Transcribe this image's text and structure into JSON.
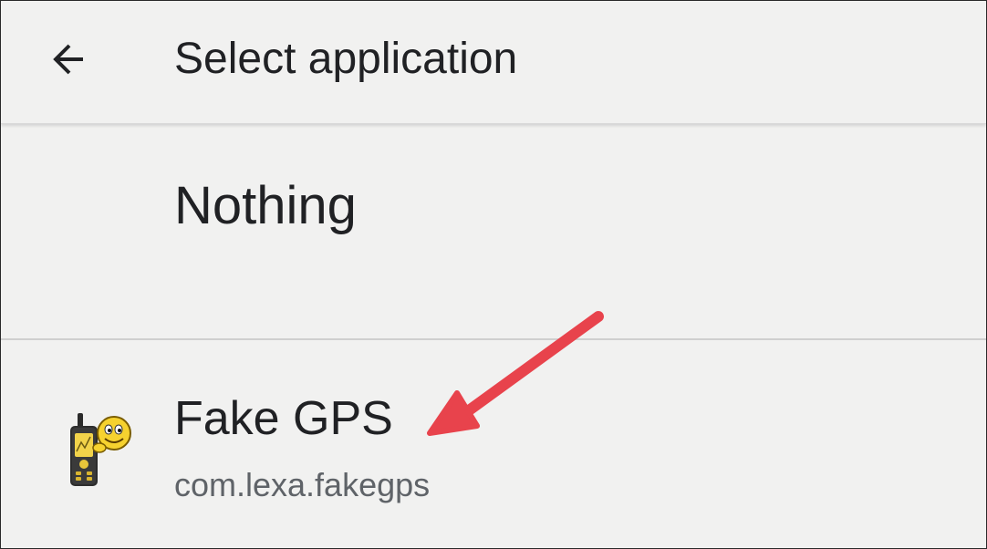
{
  "app_bar": {
    "back_icon": "arrow-left-icon",
    "title": "Select application"
  },
  "list": {
    "items": [
      {
        "title": "Nothing"
      },
      {
        "title": "Fake GPS",
        "subtitle": "com.lexa.fakegps",
        "icon": "fake-gps-app-icon"
      }
    ]
  },
  "annotation": {
    "type": "arrow",
    "points_to": "Fake GPS",
    "color": "#e8434c"
  },
  "colors": {
    "background": "#f1f1f0",
    "text_primary": "#202124",
    "text_secondary": "#5f6368",
    "divider": "#cfcfcf"
  }
}
